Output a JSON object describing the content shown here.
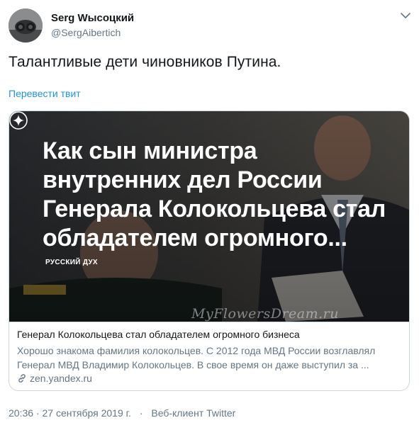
{
  "author": {
    "display_name": "Serg Wысоцкий",
    "handle": "@SergAibertich"
  },
  "tweet": {
    "text": "Талантливые дети чиновников Путина.",
    "translate_link": "Перевести твит"
  },
  "card": {
    "image": {
      "headline": "Как сын министра внутренних дел России Генерала Колокольцева стал обладателем огромного...",
      "source_label": "РУССКИЙ ДУХ",
      "watermark": "MyFlowersDream.ru"
    },
    "title": "Генерал Колокольцева стал обладателем огромного бизнеса",
    "description": "Хорошо знакома фамилия колокольцев. С 2012 года МВД России возглавлял Генерал МВД Владимир Колокольцев. В свое время он даже выступил за ...",
    "domain": "zen.yandex.ru"
  },
  "meta": {
    "time": "20:36",
    "date": "27 сентября 2019 г.",
    "client": "Веб-клиент Twitter"
  },
  "colors": {
    "link": "#1b95e0",
    "secondary_text": "#657786",
    "border": "#ccd6dd"
  },
  "icons": {
    "menu": "chevron-down-icon",
    "link": "link-icon",
    "zen": "zen-logo-icon"
  }
}
